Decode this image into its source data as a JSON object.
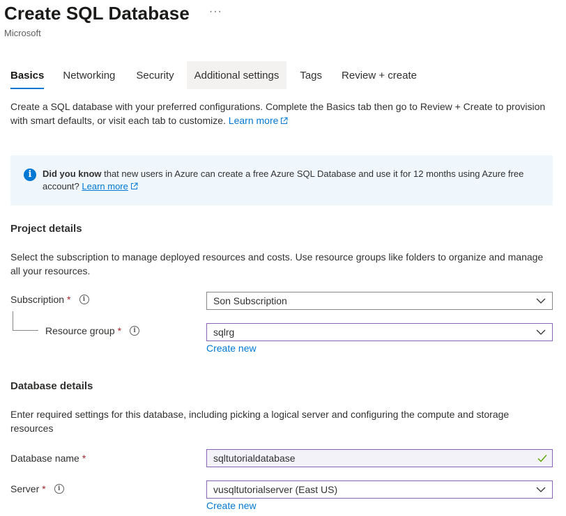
{
  "header": {
    "title": "Create SQL Database",
    "more": "···",
    "publisher": "Microsoft"
  },
  "tabs": [
    {
      "label": "Basics"
    },
    {
      "label": "Networking"
    },
    {
      "label": "Security"
    },
    {
      "label": "Additional settings"
    },
    {
      "label": "Tags"
    },
    {
      "label": "Review + create"
    }
  ],
  "intro": {
    "text": "Create a SQL database with your preferred configurations. Complete the Basics tab then go to Review + Create to provision with smart defaults, or visit each tab to customize.",
    "link": "Learn more"
  },
  "info": {
    "bold": "Did you know",
    "text": " that new users in Azure can create a free Azure SQL Database and use it for 12 months using Azure free account?",
    "link": "Learn more"
  },
  "project": {
    "heading": "Project details",
    "description": "Select the subscription to manage deployed resources and costs. Use resource groups like folders to organize and manage all your resources.",
    "subscription_label": "Subscription",
    "subscription_value": "Son Subscription",
    "resource_group_label": "Resource group",
    "resource_group_value": "sqlrg",
    "create_new": "Create new"
  },
  "database": {
    "heading": "Database details",
    "description": "Enter required settings for this database, including picking a logical server and configuring the compute and storage resources",
    "name_label": "Database name",
    "name_value": "sqltutorialdatabase",
    "server_label": "Server",
    "server_value": "vusqltutorialserver (East US)",
    "create_new": "Create new"
  },
  "required_mark": "*",
  "info_glyph": "i",
  "colors": {
    "accent": "#0078d4",
    "required": "#a4262c",
    "focus_border": "#8764b8",
    "info_bg": "#eff6fc",
    "valid": "#57a300"
  }
}
